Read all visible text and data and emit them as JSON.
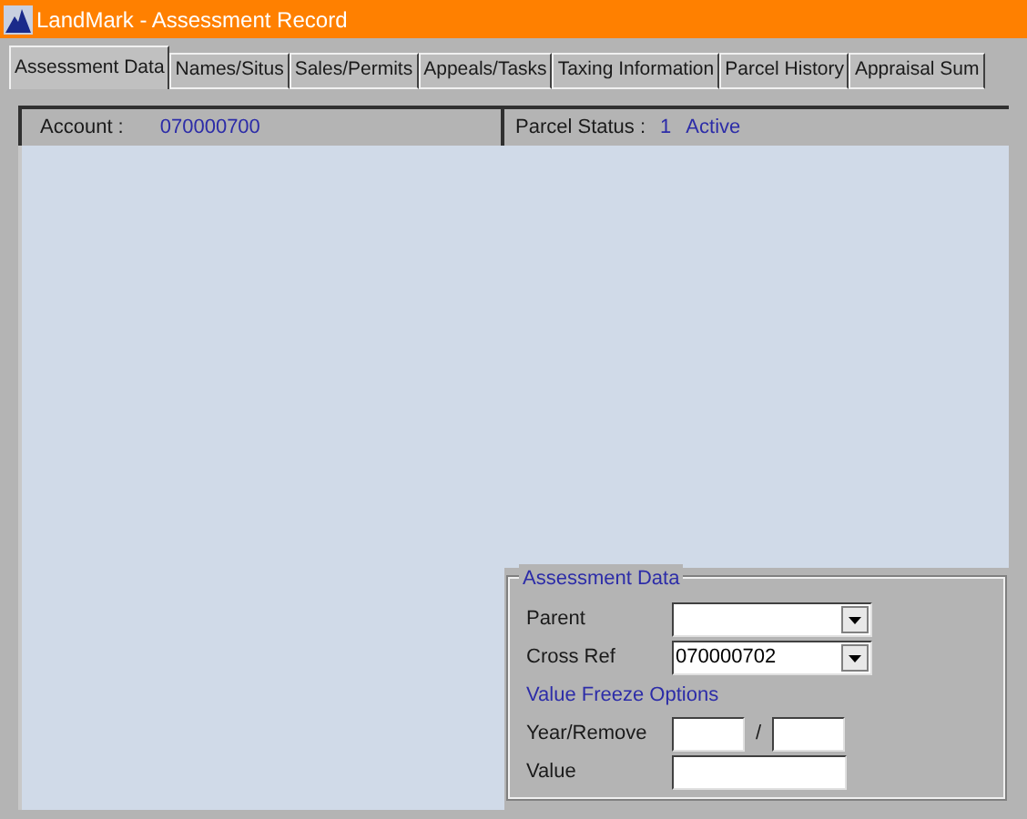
{
  "window": {
    "title": "LandMark - Assessment Record"
  },
  "tabs": [
    {
      "label": "Assessment Data",
      "selected": true
    },
    {
      "label": "Names/Situs",
      "selected": false
    },
    {
      "label": "Sales/Permits",
      "selected": false
    },
    {
      "label": "Appeals/Tasks",
      "selected": false
    },
    {
      "label": "Taxing Information",
      "selected": false
    },
    {
      "label": "Parcel History",
      "selected": false
    },
    {
      "label": "Appraisal Sum",
      "selected": false
    }
  ],
  "header": {
    "account_label": "Account :",
    "account": "070000700",
    "status_label": "Parcel Status :",
    "status_code": "1",
    "status": "Active"
  },
  "assessment_group": {
    "title": "Assessment Data",
    "fields": [
      {
        "kind": "dropdown",
        "label": "Parent"
      },
      {
        "kind": "dropdown",
        "label": "Cross Ref",
        "value": "070000702"
      },
      {
        "kind": "heading",
        "label": "Value Freeze Options"
      },
      {
        "kind": "pair",
        "label": "Year/Remove",
        "separator": "/"
      },
      {
        "kind": "text",
        "label": "Value"
      }
    ]
  }
}
